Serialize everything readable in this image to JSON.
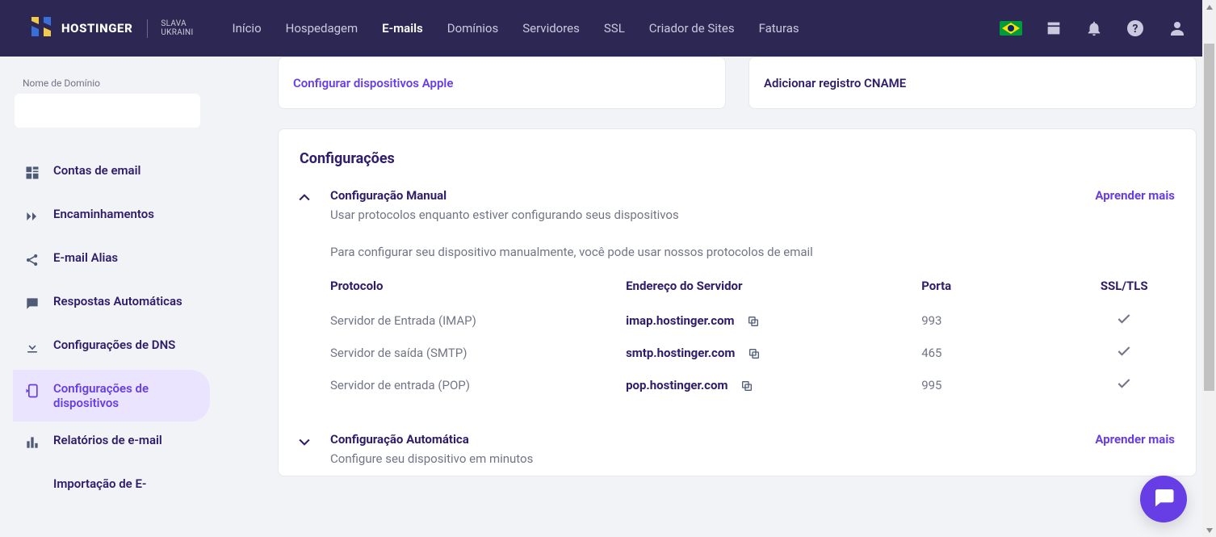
{
  "colors": {
    "primary": "#673de6",
    "topbar": "#2d2753",
    "text": "#2f1c6a",
    "muted": "#727586"
  },
  "topbar": {
    "brand": "HOSTINGER",
    "slava_line1": "SLAVA",
    "slava_line2": "UKRAINI",
    "nav": {
      "inicio": "Início",
      "hospedagem": "Hospedagem",
      "emails": "E-mails",
      "dominios": "Domínios",
      "servidores": "Servidores",
      "ssl": "SSL",
      "criador": "Criador de Sites",
      "faturas": "Faturas"
    }
  },
  "sidebar": {
    "domain_label": "Nome de Domínio",
    "domain_value": "",
    "items": {
      "contas": "Contas de email",
      "encaminhamentos": "Encaminhamentos",
      "alias": "E-mail Alias",
      "respostas": "Respostas Automáticas",
      "dns": "Configurações de DNS",
      "dispositivos": "Configurações de dispositivos",
      "relatorios": "Relatórios de e-mail",
      "importacao": "Importação de E-"
    }
  },
  "cards": {
    "apple": "Configurar dispositivos Apple",
    "cname": "Adicionar registro CNAME"
  },
  "config": {
    "section_title": "Configurações",
    "manual": {
      "title": "Configuração Manual",
      "subtitle": "Usar protocolos enquanto estiver configurando seus dispositivos",
      "learn": "Aprender mais",
      "intro": "Para configurar seu dispositivo manualmente, você pode usar nossos protocolos de email",
      "headers": {
        "protocol": "Protocolo",
        "address": "Endereço do Servidor",
        "port": "Porta",
        "ssl": "SSL/TLS"
      },
      "rows": [
        {
          "protocol": "Servidor de Entrada (IMAP)",
          "address": "imap.hostinger.com",
          "port": "993"
        },
        {
          "protocol": "Servidor de saída (SMTP)",
          "address": "smtp.hostinger.com",
          "port": "465"
        },
        {
          "protocol": "Servidor de entrada (POP)",
          "address": "pop.hostinger.com",
          "port": "995"
        }
      ]
    },
    "auto": {
      "title": "Configuração Automática",
      "subtitle": "Configure seu dispositivo em minutos",
      "learn": "Aprender mais"
    }
  }
}
